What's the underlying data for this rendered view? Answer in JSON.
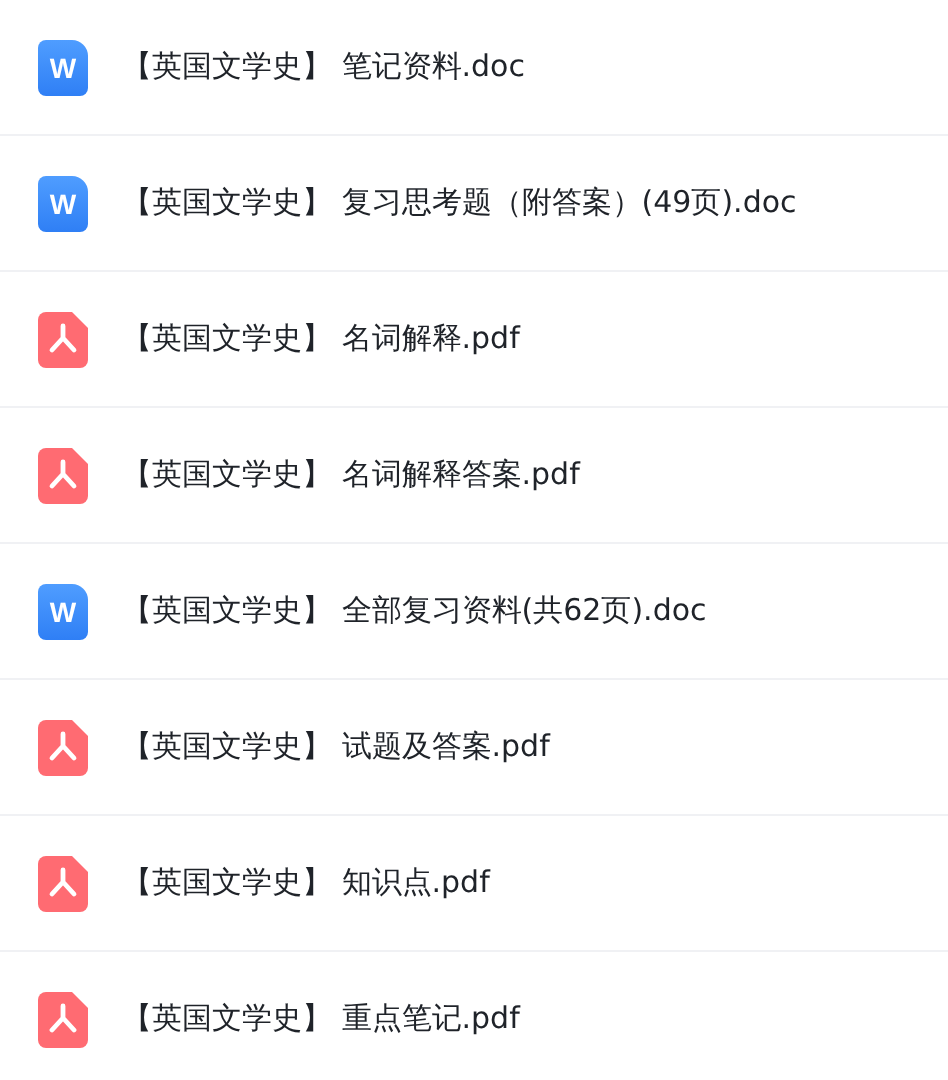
{
  "files": [
    {
      "kind": "doc",
      "icon_letter": "W",
      "name": "【英国文学史】 笔记资料.doc"
    },
    {
      "kind": "doc",
      "icon_letter": "W",
      "name": "【英国文学史】 复习思考题（附答案）(49页).doc"
    },
    {
      "kind": "pdf",
      "name": "【英国文学史】 名词解释.pdf"
    },
    {
      "kind": "pdf",
      "name": "【英国文学史】 名词解释答案.pdf"
    },
    {
      "kind": "doc",
      "icon_letter": "W",
      "name": "【英国文学史】 全部复习资料(共62页).doc"
    },
    {
      "kind": "pdf",
      "name": "【英国文学史】 试题及答案.pdf"
    },
    {
      "kind": "pdf",
      "name": "【英国文学史】 知识点.pdf"
    },
    {
      "kind": "pdf",
      "name": "【英国文学史】 重点笔记.pdf"
    }
  ]
}
